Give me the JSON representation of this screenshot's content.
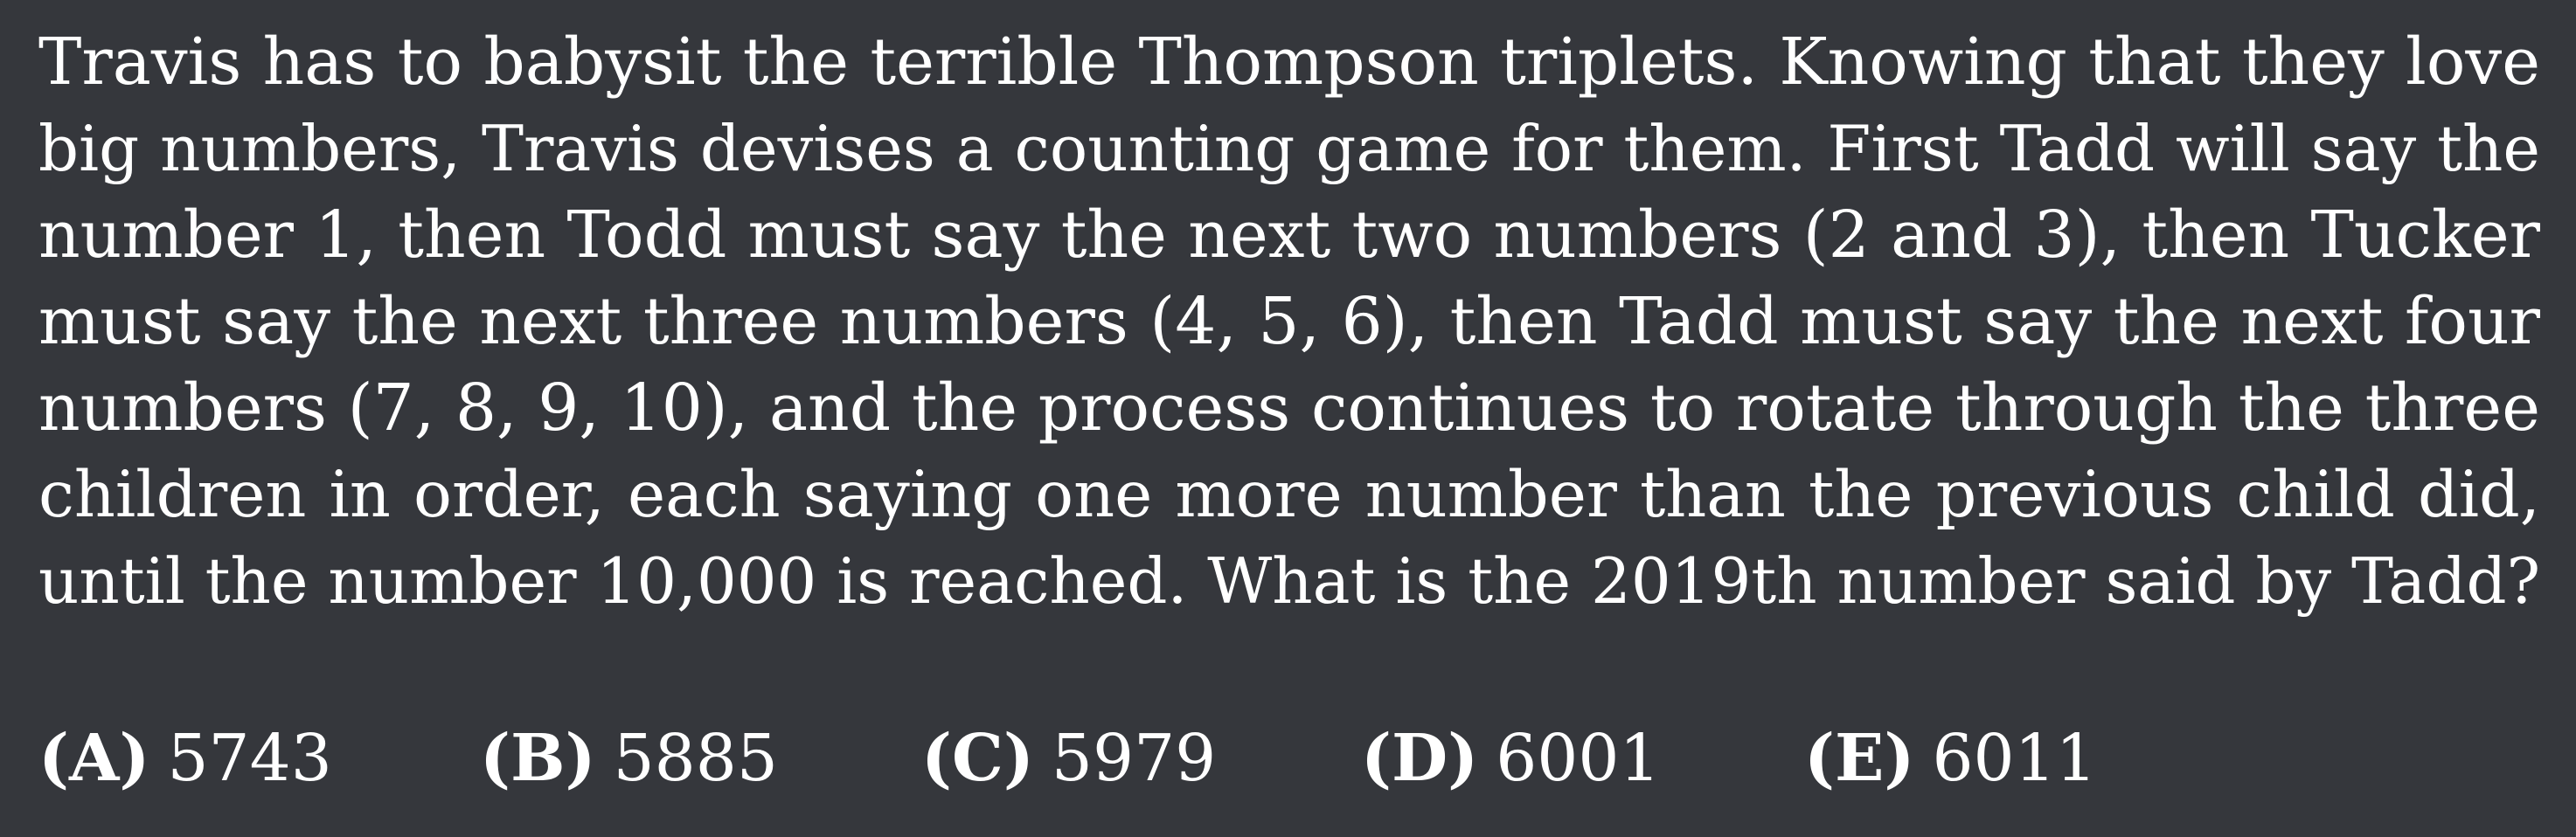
{
  "problem": {
    "lines": [
      "Travis has to babysit the terrible Thompson triplets. Knowing that they love",
      "big numbers, Travis devises a counting game for them. First Tadd will say the",
      "number 1, then Todd must say the next two numbers (2 and 3), then Tucker",
      "must say the next three numbers (4, 5, 6), then Tadd must say the next four",
      "numbers (7, 8, 9, 10), and the process continues to rotate through the three",
      "children in order, each saying one more number than the previous child did,",
      "until the number 10,000 is reached. What is the 2019th number said by Tadd?"
    ]
  },
  "choices": [
    {
      "letter": "(A)",
      "value": "5743"
    },
    {
      "letter": "(B)",
      "value": "5885"
    },
    {
      "letter": "(C)",
      "value": "5979"
    },
    {
      "letter": "(D)",
      "value": "6001"
    },
    {
      "letter": "(E)",
      "value": "6011"
    }
  ]
}
